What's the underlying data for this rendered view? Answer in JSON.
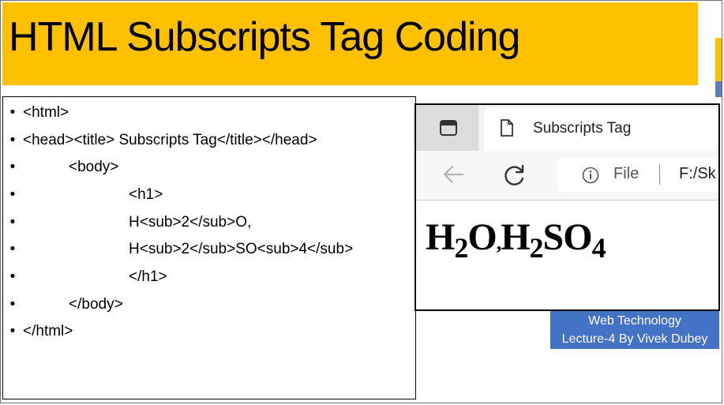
{
  "slide": {
    "title": "HTML Subscripts Tag Coding",
    "code_lines": [
      {
        "bullet": "•",
        "text": "<html>",
        "indent": 0
      },
      {
        "bullet": "•",
        "text": "<head><title> Subscripts Tag</title></head>",
        "indent": 0
      },
      {
        "bullet": "•",
        "text": "<body>",
        "indent": 1
      },
      {
        "bullet": "•",
        "text": "<h1>",
        "indent": 2
      },
      {
        "bullet": "•",
        "text": "H<sub>2</sub>O,",
        "indent": 2
      },
      {
        "bullet": "•",
        "text": "H<sub>2</sub>SO<sub>4</sub>",
        "indent": 2
      },
      {
        "bullet": "•",
        "text": "</h1>",
        "indent": 2
      },
      {
        "bullet": "•",
        "text": "</body>",
        "indent": 1
      },
      {
        "bullet": "•",
        "text": "</html>",
        "indent": 0
      }
    ],
    "caption": {
      "line1": "Web Technology",
      "line2": "Lecture-4 By Vivek Dubey"
    },
    "colors": {
      "title_bg": "#ffc000",
      "caption_bg": "#4472c4"
    }
  },
  "browser": {
    "tab_title": "Subscripts Tag",
    "address_label": "File",
    "address_path": "F:/Sk",
    "icons": {
      "tab_actions": "tab-actions-icon",
      "page": "document-icon",
      "back": "back-arrow-icon",
      "refresh": "refresh-icon",
      "info": "info-icon"
    },
    "render": {
      "h": "H",
      "sub1": "2",
      "o": "O",
      "comma": ",",
      "h2": "H",
      "sub2": "2",
      "so": "SO",
      "sub3": "4"
    }
  }
}
